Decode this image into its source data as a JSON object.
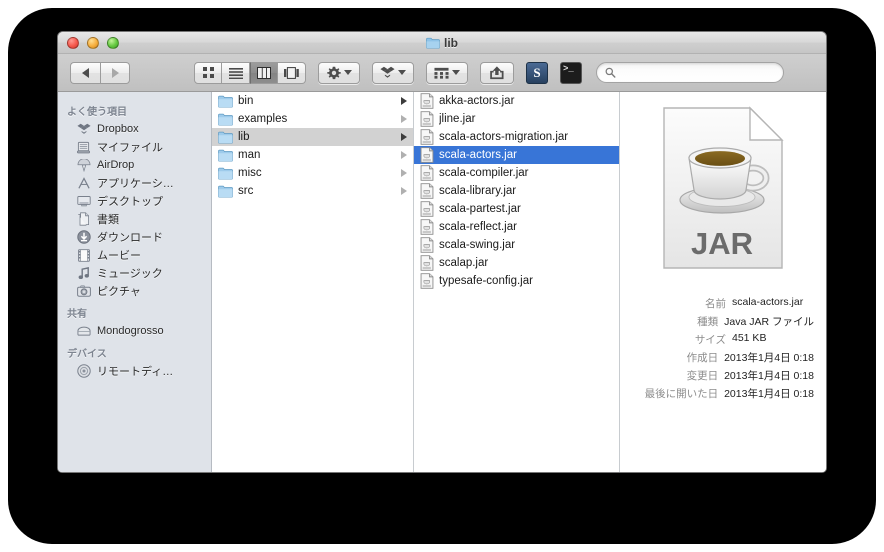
{
  "window": {
    "title": "lib",
    "title_icon": "folder-icon",
    "traffic_lights": [
      "close",
      "minimize",
      "zoom"
    ]
  },
  "toolbar": {
    "back_icon": "chevron-left-icon",
    "forward_icon": "chevron-right-icon",
    "view_modes": [
      {
        "name": "icon-view",
        "icon": "grid-icon",
        "active": false
      },
      {
        "name": "list-view",
        "icon": "list-icon",
        "active": false
      },
      {
        "name": "column-view",
        "icon": "columns-icon",
        "active": true
      },
      {
        "name": "coverflow-view",
        "icon": "coverflow-icon",
        "active": false
      }
    ],
    "action_icon": "gear-icon",
    "dropbox_icon": "dropbox-icon",
    "arrange_icon": "arrange-grid-icon",
    "share_icon": "share-arrow-icon",
    "app_icons": [
      {
        "name": "sublime-text-icon",
        "label": "S"
      },
      {
        "name": "terminal-icon",
        "label": ">_"
      }
    ],
    "search": {
      "icon": "search-icon",
      "value": "",
      "placeholder": ""
    }
  },
  "sidebar": {
    "sections": [
      {
        "header": "よく使う項目",
        "items": [
          {
            "label": "Dropbox",
            "icon": "dropbox-icon"
          },
          {
            "label": "マイファイル",
            "icon": "myfiles-icon"
          },
          {
            "label": "AirDrop",
            "icon": "airdrop-icon"
          },
          {
            "label": "アプリケーシ…",
            "icon": "applications-icon"
          },
          {
            "label": "デスクトップ",
            "icon": "desktop-icon"
          },
          {
            "label": "書類",
            "icon": "documents-icon"
          },
          {
            "label": "ダウンロード",
            "icon": "downloads-icon"
          },
          {
            "label": "ムービー",
            "icon": "movies-icon"
          },
          {
            "label": "ミュージック",
            "icon": "music-icon"
          },
          {
            "label": "ピクチャ",
            "icon": "pictures-icon"
          }
        ]
      },
      {
        "header": "共有",
        "items": [
          {
            "label": "Mondogrosso",
            "icon": "shared-computer-icon"
          }
        ]
      },
      {
        "header": "デバイス",
        "items": [
          {
            "label": "リモートディ…",
            "icon": "remote-disc-icon"
          }
        ]
      }
    ]
  },
  "columns": {
    "column1": {
      "items": [
        {
          "label": "bin",
          "icon": "folder-icon",
          "selected": false,
          "has_children": true
        },
        {
          "label": "examples",
          "icon": "folder-icon",
          "selected": false,
          "has_children": true
        },
        {
          "label": "lib",
          "icon": "folder-icon",
          "selected": true,
          "has_children": true
        },
        {
          "label": "man",
          "icon": "folder-icon",
          "selected": false,
          "has_children": true
        },
        {
          "label": "misc",
          "icon": "folder-icon",
          "selected": false,
          "has_children": true
        },
        {
          "label": "src",
          "icon": "folder-icon",
          "selected": false,
          "has_children": true
        }
      ]
    },
    "column2": {
      "items": [
        {
          "label": "akka-actors.jar",
          "icon": "jar-file-icon",
          "selected": false
        },
        {
          "label": "jline.jar",
          "icon": "jar-file-icon",
          "selected": false
        },
        {
          "label": "scala-actors-migration.jar",
          "icon": "jar-file-icon",
          "selected": false
        },
        {
          "label": "scala-actors.jar",
          "icon": "jar-file-icon",
          "selected": true
        },
        {
          "label": "scala-compiler.jar",
          "icon": "jar-file-icon",
          "selected": false
        },
        {
          "label": "scala-library.jar",
          "icon": "jar-file-icon",
          "selected": false
        },
        {
          "label": "scala-partest.jar",
          "icon": "jar-file-icon",
          "selected": false
        },
        {
          "label": "scala-reflect.jar",
          "icon": "jar-file-icon",
          "selected": false
        },
        {
          "label": "scala-swing.jar",
          "icon": "jar-file-icon",
          "selected": false
        },
        {
          "label": "scalap.jar",
          "icon": "jar-file-icon",
          "selected": false
        },
        {
          "label": "typesafe-config.jar",
          "icon": "jar-file-icon",
          "selected": false
        }
      ]
    }
  },
  "preview": {
    "icon": "java-jar-coffee-cup-icon",
    "icon_label": "JAR",
    "metadata": [
      {
        "key": "名前",
        "value": "scala-actors.jar"
      },
      {
        "key": "種類",
        "value": "Java JAR ファイル"
      },
      {
        "key": "サイズ",
        "value": "451 KB"
      },
      {
        "key": "作成日",
        "value": "2013年1月4日 0:18"
      },
      {
        "key": "変更日",
        "value": "2013年1月4日 0:18"
      },
      {
        "key": "最後に開いた日",
        "value": "2013年1月4日 0:18"
      }
    ]
  },
  "colors": {
    "selection_blue": "#3875d7",
    "selection_gray": "#d2d2d2",
    "sidebar_bg": "#dfe3e9",
    "backdrop": "#000000"
  }
}
